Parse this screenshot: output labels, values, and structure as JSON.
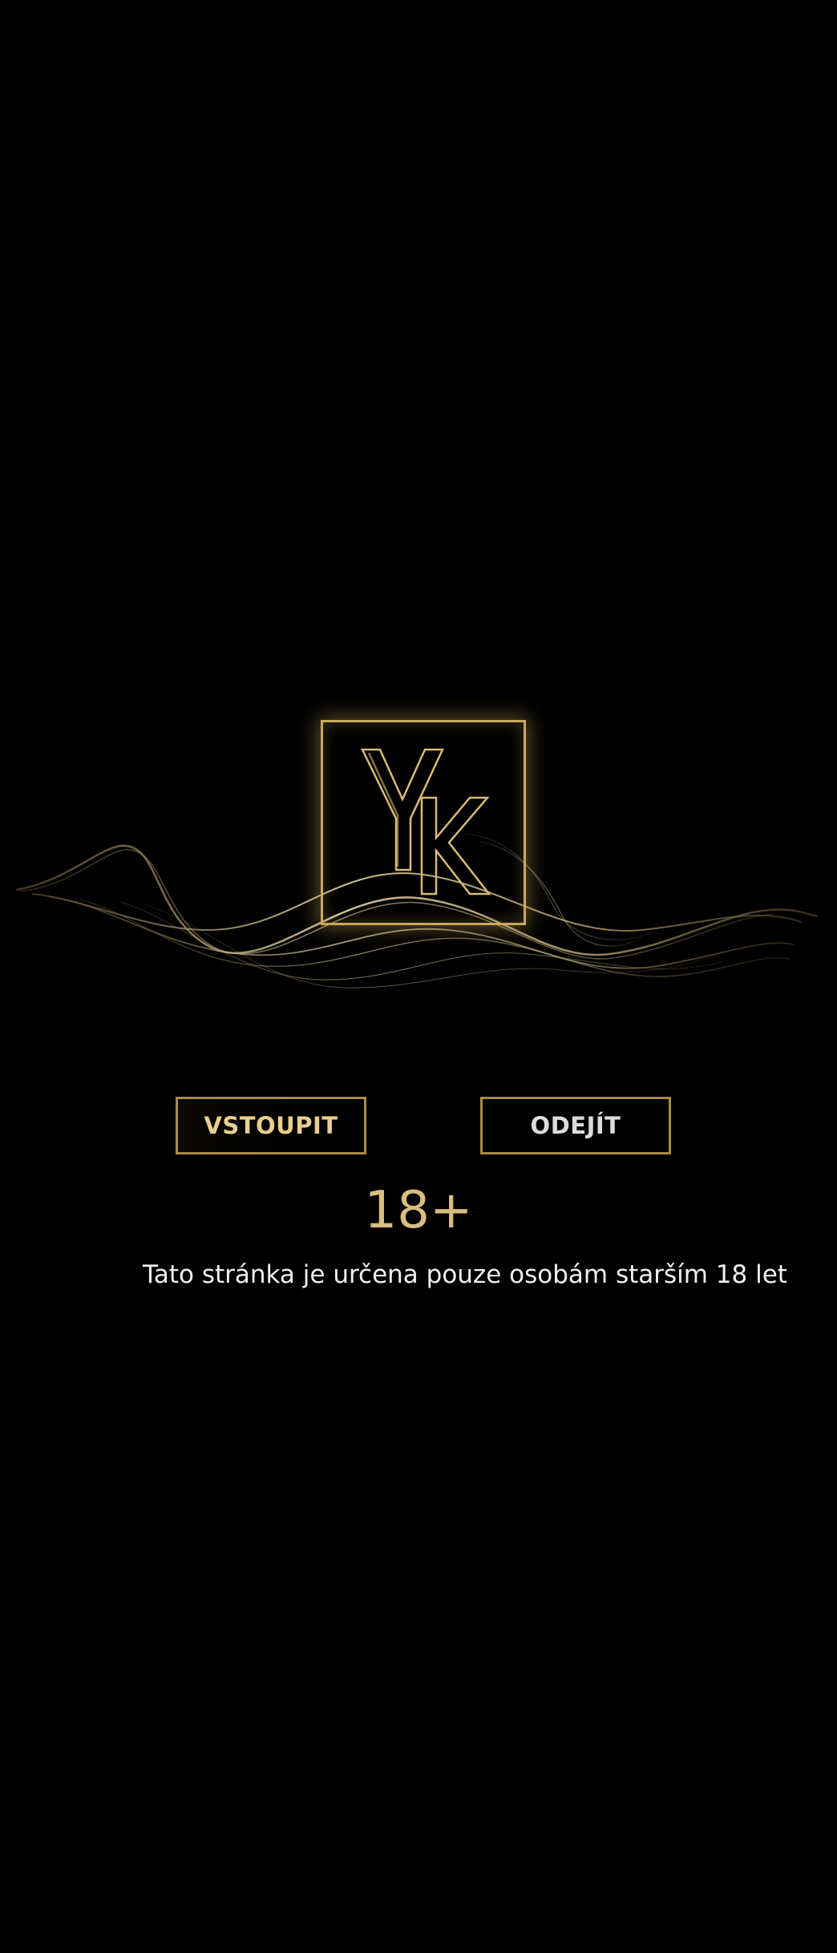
{
  "brand": {
    "logo_text": "YK",
    "accent_color": "#c9a85c"
  },
  "actions": {
    "enter_label": "VSTOUPIT",
    "exit_label": "ODEJÍT"
  },
  "age_gate": {
    "age_label": "18+",
    "notice": "Tato stránka je určena pouze osobám starším 18 let"
  }
}
